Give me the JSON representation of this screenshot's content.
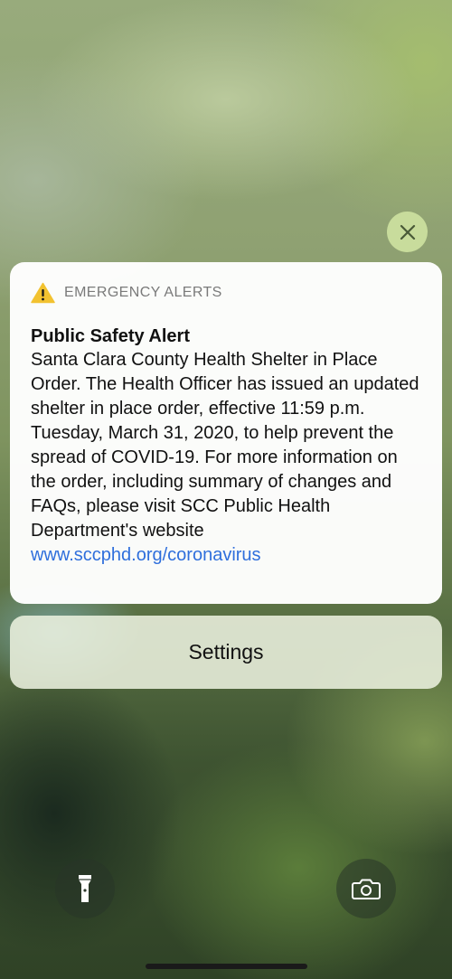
{
  "alert": {
    "app_name": "EMERGENCY ALERTS",
    "title": "Public Safety Alert",
    "body": "Santa Clara County Health Shelter in Place Order. The Health Officer has issued an updated shelter in place order, effective 11:59 p.m. Tuesday, March 31, 2020, to help prevent the spread of COVID-19. For more information on the order, including summary of changes and FAQs, please visit SCC Public Health Department's website ",
    "link_text": "www.sccphd.org/coronavirus"
  },
  "actions": {
    "settings_label": "Settings"
  },
  "icons": {
    "close": "close-icon",
    "warning": "warning-triangle-icon",
    "flashlight": "flashlight-icon",
    "camera": "camera-icon"
  },
  "colors": {
    "link": "#2f6fdc",
    "warning": "#f2c230"
  }
}
